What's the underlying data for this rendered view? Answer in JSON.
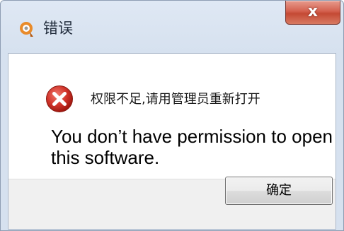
{
  "window": {
    "title": "错误",
    "close_glyph": "x",
    "app_icon": "app-logo-icon"
  },
  "dialog": {
    "icon": "error-icon",
    "message_cn": "权限不足,请用管理员重新打开",
    "message_en": "You don’t have permission to open this software.",
    "ok_label": "确定"
  },
  "colors": {
    "close_button": "#c44934",
    "error_icon": "#c8281d",
    "app_icon": "#e98b2a"
  }
}
